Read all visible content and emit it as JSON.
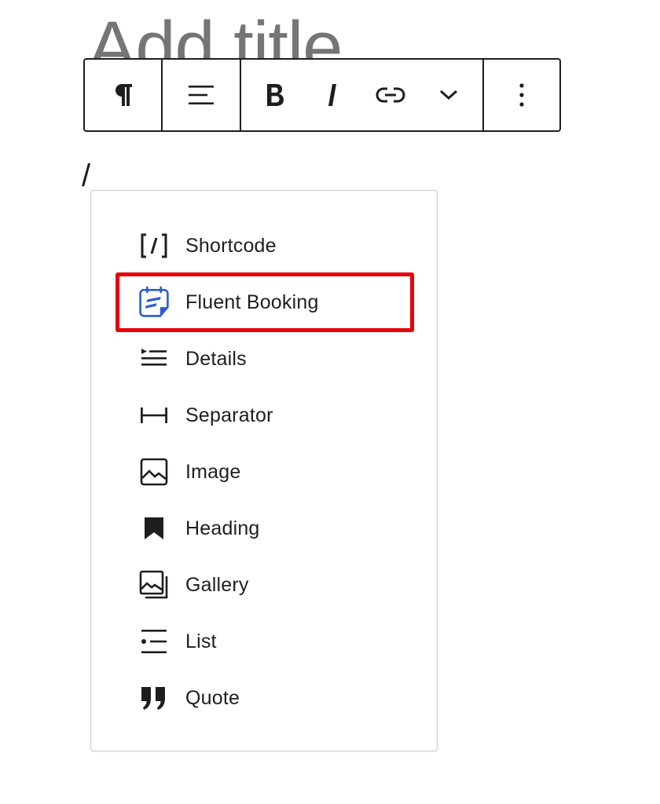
{
  "editor": {
    "title_placeholder": "Add title",
    "paragraph_text": "/"
  },
  "toolbar": {
    "buttons": [
      {
        "name": "paragraph",
        "icon": "pilcrow-icon"
      },
      {
        "name": "align",
        "icon": "align-left-icon"
      },
      {
        "name": "bold",
        "icon": "bold-icon"
      },
      {
        "name": "italic",
        "icon": "italic-icon"
      },
      {
        "name": "link",
        "icon": "link-icon"
      },
      {
        "name": "more-formatting",
        "icon": "chevron-down-icon"
      },
      {
        "name": "options",
        "icon": "vertical-ellipsis-icon"
      }
    ]
  },
  "inserter": {
    "items": [
      {
        "label": "Shortcode",
        "icon": "shortcode-icon"
      },
      {
        "label": "Fluent Booking",
        "icon": "fluent-booking-icon",
        "highlighted": true
      },
      {
        "label": "Details",
        "icon": "details-icon"
      },
      {
        "label": "Separator",
        "icon": "separator-icon"
      },
      {
        "label": "Image",
        "icon": "image-icon"
      },
      {
        "label": "Heading",
        "icon": "heading-bookmark-icon"
      },
      {
        "label": "Gallery",
        "icon": "gallery-icon"
      },
      {
        "label": "List",
        "icon": "list-icon"
      },
      {
        "label": "Quote",
        "icon": "quote-icon"
      }
    ]
  },
  "colors": {
    "highlight": "#e8000b",
    "fluent_brand": "#2b5cd6",
    "text": "#1e1e1e",
    "placeholder": "#757575"
  }
}
